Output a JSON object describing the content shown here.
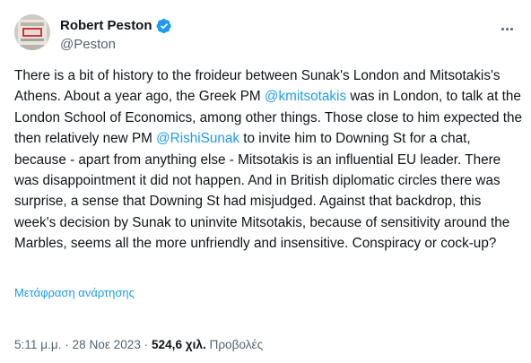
{
  "author": {
    "display_name": "Robert Peston",
    "handle": "@Peston",
    "verified_color": "#1d9bf0",
    "avatar_icon": "avatar-photo"
  },
  "more_icon": "more-horizontal-icon",
  "tweet": {
    "seg1": "There is a bit of history to the froideur between Sunak's London and Mitsotakis's Athens. About a year ago, the Greek PM ",
    "mention1": "@kmitsotakis",
    "seg2": " was in London, to talk at the London School of Economics, among other things. Those close to him expected the then relatively new PM ",
    "mention2": "@RishiSunak",
    "seg3": " to invite him to Downing St for a chat, because - apart from anything else - Mitsotakis is an influential EU leader. There was disappointment it did not happen. And in British diplomatic circles there was surprise, a sense that Downing St had misjudged. Against that backdrop, this week's decision by Sunak to uninvite Mitsotakis, because of sensitivity around the Marbles, seems all the more unfriendly and insensitive. Conspiracy or cock-up?"
  },
  "translate_label": "Μετάφραση ανάρτησης",
  "meta": {
    "time": "5:11 μ.μ.",
    "sep1": " · ",
    "date": "28 Νοε 2023",
    "sep2": " · ",
    "views_count": "524,6 χιλ.",
    "views_label": " Προβολές"
  },
  "colors": {
    "text": "#0f1419",
    "secondary": "#536471",
    "link": "#1d9bf0"
  }
}
